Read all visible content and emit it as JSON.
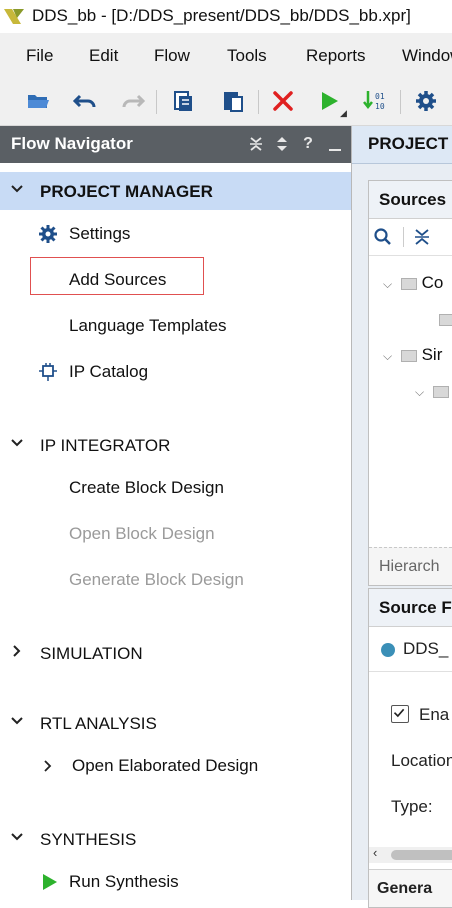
{
  "window": {
    "title": "DDS_bb - [D:/DDS_present/DDS_bb/DDS_bb.xpr]"
  },
  "menu": [
    "File",
    "Edit",
    "Flow",
    "Tools",
    "Reports",
    "Window"
  ],
  "toolbar": {
    "icons": [
      "open-project-icon",
      "undo-icon",
      "redo-icon",
      "copy-icon",
      "paste-icon",
      "delete-icon",
      "run-icon",
      "generate-bitstream-icon",
      "settings-icon"
    ]
  },
  "flow_navigator": {
    "title": "Flow Navigator",
    "header_help": "?",
    "sections": [
      {
        "label": "PROJECT MANAGER",
        "expanded": true,
        "active": true,
        "items": [
          {
            "label": "Settings",
            "icon": "gear-icon",
            "enabled": true
          },
          {
            "label": "Add Sources",
            "enabled": true,
            "highlighted": true
          },
          {
            "label": "Language Templates",
            "enabled": true
          },
          {
            "label": "IP Catalog",
            "icon": "ip-catalog-icon",
            "enabled": true
          }
        ]
      },
      {
        "label": "IP INTEGRATOR",
        "expanded": true,
        "items": [
          {
            "label": "Create Block Design",
            "enabled": true
          },
          {
            "label": "Open Block Design",
            "enabled": false
          },
          {
            "label": "Generate Block Design",
            "enabled": false
          }
        ]
      },
      {
        "label": "SIMULATION",
        "expanded": false
      },
      {
        "label": "RTL ANALYSIS",
        "expanded": true,
        "items": [
          {
            "label": "Open Elaborated Design",
            "enabled": true,
            "expandable": true
          }
        ]
      },
      {
        "label": "SYNTHESIS",
        "expanded": true,
        "items": [
          {
            "label": "Run Synthesis",
            "icon": "run-icon",
            "enabled": true
          }
        ]
      }
    ]
  },
  "right_panel": {
    "tab_title": "PROJECT",
    "sources": {
      "title": "Sources",
      "tree": [
        "Co",
        "Sir"
      ],
      "footer_tab": "Hierarch"
    },
    "source_properties": {
      "title": "Source F",
      "file": "DDS_",
      "enabled_label": "Ena",
      "location_label": "Location",
      "type_label": "Type:",
      "general_tab": "Genera"
    }
  },
  "colors": {
    "accent": "#c8dbf5",
    "header": "#5a5f64",
    "highlight_box": "#e05050",
    "run_green": "#2db22d",
    "delete_red": "#e02020"
  }
}
